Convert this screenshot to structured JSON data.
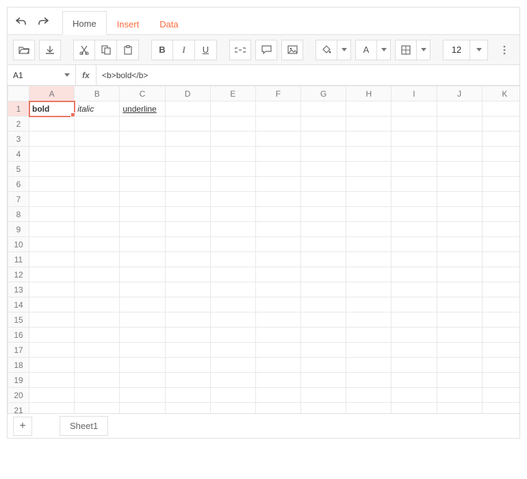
{
  "tabs": {
    "home": "Home",
    "insert": "Insert",
    "data": "Data",
    "active": "Home"
  },
  "cellRef": "A1",
  "fxLabel": "fx",
  "formula": "<b>bold</b>",
  "fontSize": "12",
  "columns": [
    "A",
    "B",
    "C",
    "D",
    "E",
    "F",
    "G",
    "H",
    "I",
    "J",
    "K"
  ],
  "rowCount": 21,
  "activeCell": {
    "row": 1,
    "col": "A"
  },
  "cells": {
    "A1": {
      "text": "bold",
      "style": "bold"
    },
    "B1": {
      "text": "italic",
      "style": "italic"
    },
    "C1": {
      "text": "underline",
      "style": "underline"
    }
  },
  "sheet": {
    "name": "Sheet1"
  },
  "icons": {
    "undo": "undo-icon",
    "redo": "redo-icon",
    "open": "folder-open-icon",
    "download": "download-icon",
    "cut": "scissors-icon",
    "copy": "copy-icon",
    "paste": "clipboard-icon",
    "bold": "B",
    "italic": "I",
    "underline": "U",
    "link": "link-icon",
    "comment": "comment-icon",
    "image": "image-icon",
    "fill": "paint-bucket-icon",
    "fontcolor": "A",
    "border": "border-icon",
    "more": "more-vertical-icon",
    "add": "+"
  }
}
